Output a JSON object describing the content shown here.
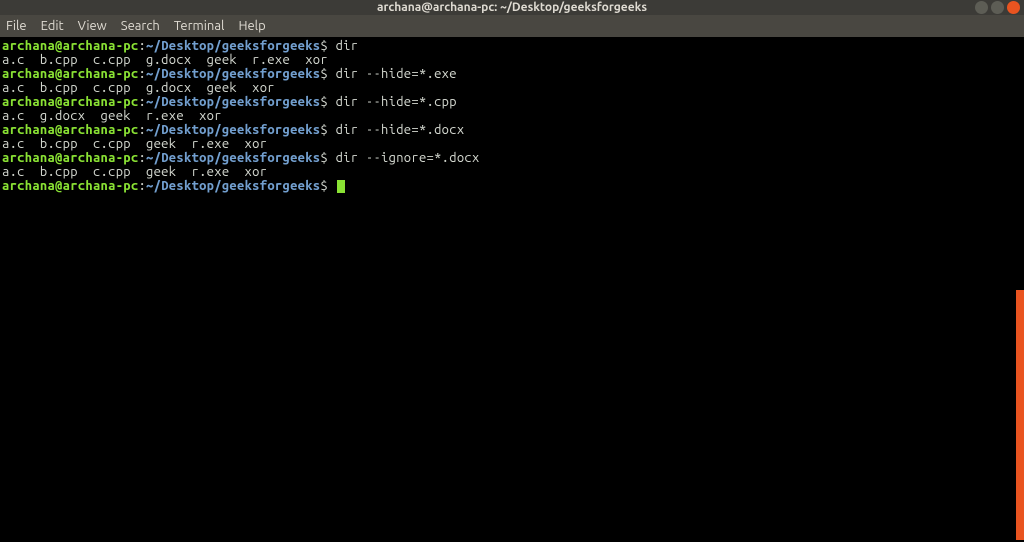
{
  "titlebar": {
    "title": "archana@archana-pc: ~/Desktop/geeksforgeeks"
  },
  "menubar": {
    "items": [
      "File",
      "Edit",
      "View",
      "Search",
      "Terminal",
      "Help"
    ]
  },
  "prompt": {
    "user": "archana@archana-pc",
    "sep": ":",
    "path": "~/Desktop/geeksforgeeks",
    "symbol": "$"
  },
  "session": [
    {
      "type": "cmd",
      "command": "dir"
    },
    {
      "type": "out",
      "text": "a.c  b.cpp  c.cpp  g.docx  geek  r.exe  xor"
    },
    {
      "type": "cmd",
      "command": "dir --hide=*.exe"
    },
    {
      "type": "out",
      "text": "a.c  b.cpp  c.cpp  g.docx  geek  xor"
    },
    {
      "type": "cmd",
      "command": "dir --hide=*.cpp"
    },
    {
      "type": "out",
      "text": "a.c  g.docx  geek  r.exe  xor"
    },
    {
      "type": "cmd",
      "command": "dir --hide=*.docx"
    },
    {
      "type": "out",
      "text": "a.c  b.cpp  c.cpp  geek  r.exe  xor"
    },
    {
      "type": "cmd",
      "command": "dir --ignore=*.docx"
    },
    {
      "type": "out",
      "text": "a.c  b.cpp  c.cpp  geek  r.exe  xor"
    },
    {
      "type": "cmd",
      "command": "",
      "cursor": true
    }
  ]
}
